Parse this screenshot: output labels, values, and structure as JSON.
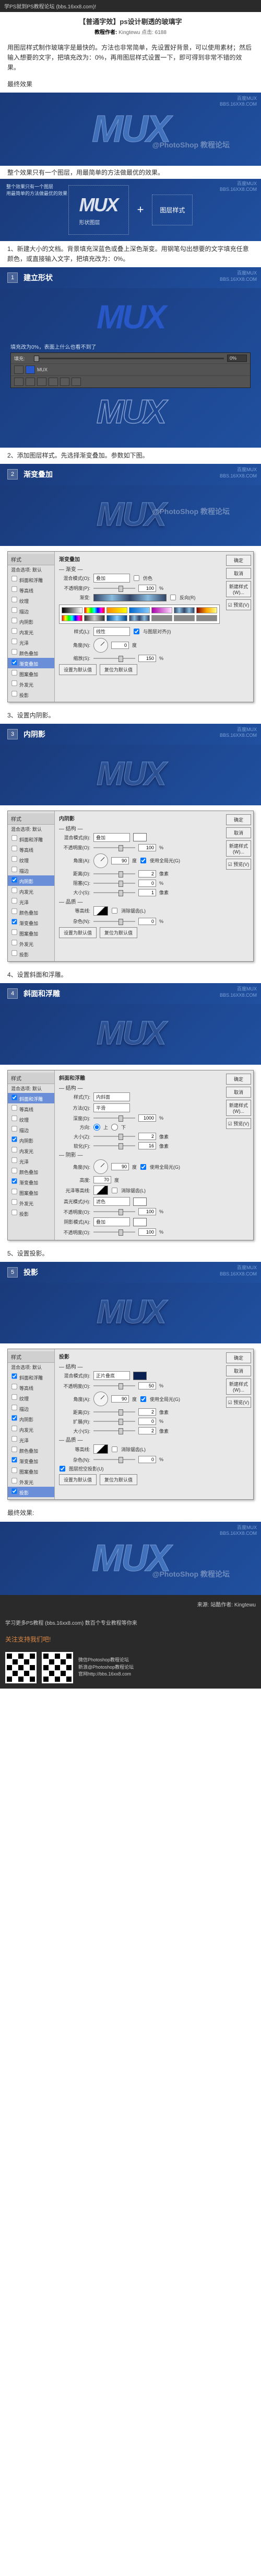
{
  "header": {
    "site": "学PS就到PS教程论坛 (bbs.16xx8.com)!"
  },
  "title": {
    "main": "【普通字效】ps设计剔透的玻璃字",
    "author_label": "教程作者:",
    "author": "Kingtewu",
    "meta": "点击: 6188"
  },
  "intro": "用图层样式制作玻璃字是最快的。方法也非常简单，先设置好背景，可以使用素材；然后输入想要的文字，把填充改为：0%，再用图层样式设置一下，即可得到非常不错的效果。",
  "final_label": "最终效果",
  "brand_label": {
    "l1": "百度MUX",
    "l2": "BBS.16XX8.COM"
  },
  "watermark": "@PhotoShop 教程论坛",
  "logo_text": "MUX",
  "caption_simple": "整个效果只有一个图层，用最简单的方法做最优的效果。",
  "formula": {
    "caption1": "整个效果只有一个图层",
    "caption2": "用最简单的方法做最优的效果",
    "left_label": "形状图层",
    "plus": "+",
    "right": "图层样式"
  },
  "step1": {
    "num": "1",
    "title": "建立形状",
    "text": "1、新建大小的文档。背景填充深蓝色或叠上深色渐变。用钢笔勾出想要的文字填充任意颜色，或直接输入文字，把填充改为：0%。",
    "fill_label": "填充改为0%，表面上什么也看不到了",
    "panel": {
      "fill": "填充:",
      "val": "0%",
      "layer": "MUX"
    }
  },
  "step2": {
    "num": "2",
    "title": "渐变叠加",
    "text": "2、添加图层样式。先选择渐变叠加。参数如下图。"
  },
  "step3": {
    "num": "3",
    "title": "内阴影",
    "text": "3、设置内阴影。"
  },
  "step4": {
    "num": "4",
    "title": "斜面和浮雕",
    "text": "4、设置斜面和浮雕。"
  },
  "step5": {
    "num": "5",
    "title": "投影",
    "text": "5、设置投影。"
  },
  "dialog": {
    "side_head": "样式",
    "items": [
      "混合选项: 默认",
      "斜面和浮雕",
      "等高线",
      "纹理",
      "描边",
      "内阴影",
      "内发光",
      "光泽",
      "颜色叠加",
      "渐变叠加",
      "图案叠加",
      "外发光",
      "投影"
    ],
    "btns": {
      "ok": "确定",
      "cancel": "取消",
      "new": "新建样式(W)...",
      "preview": "☑ 预览(V)"
    }
  },
  "grad": {
    "title": "渐变叠加",
    "section": "— 渐变 —",
    "blend": "混合模式(O):",
    "blend_v": "叠加",
    "dither": "仿色",
    "opacity": "不透明度(P):",
    "opacity_v": "100",
    "pct": "%",
    "gradient": "渐变:",
    "reverse": "反向(R)",
    "style": "样式(L):",
    "style_v": "线性",
    "align": "与图层对齐(I)",
    "angle": "角度(N):",
    "angle_v": "0",
    "deg": "度",
    "scale": "缩放(S):",
    "scale_v": "150",
    "default": "设置为默认值",
    "reset": "复位为默认值"
  },
  "inner": {
    "title": "内阴影",
    "section": "— 结构 —",
    "blend": "混合模式(B):",
    "blend_v": "叠加",
    "opacity": "不透明度(O):",
    "opacity_v": "100",
    "angle": "角度(A):",
    "angle_v": "90",
    "global": "使用全局光(G)",
    "dist": "距离(D):",
    "dist_v": "2",
    "px": "像素",
    "choke": "阻塞(C):",
    "choke_v": "0",
    "size": "大小(S):",
    "size_v": "1",
    "q": "— 品质 —",
    "contour": "等高线:",
    "aa": "消除锯齿(L)",
    "noise": "杂色(N):",
    "noise_v": "0"
  },
  "bevel": {
    "title": "斜面和浮雕",
    "section": "— 结构 —",
    "style": "样式(T):",
    "style_v": "内斜面",
    "tech": "方法(Q):",
    "tech_v": "平滑",
    "depth": "深度(D):",
    "depth_v": "1000",
    "dir": "方向:",
    "up": "上",
    "down": "下",
    "size": "大小(Z):",
    "size_v": "2",
    "soft": "软化(F):",
    "soft_v": "16",
    "shade": "— 阴影 —",
    "angle": "角度(N):",
    "angle_v": "90",
    "global": "使用全局光(G)",
    "alt": "高度:",
    "alt_v": "70",
    "gloss": "光泽等高线:",
    "aa": "消除锯齿(L)",
    "hmode": "高光模式(H):",
    "hmode_v": "滤色",
    "hop": "100",
    "smode": "阴影模式(A):",
    "smode_v": "叠加",
    "sop": "100"
  },
  "drop": {
    "title": "投影",
    "section": "— 结构 —",
    "blend": "混合模式(B):",
    "blend_v": "正片叠底",
    "opacity": "不透明度(O):",
    "opacity_v": "50",
    "angle": "角度(A):",
    "angle_v": "90",
    "global": "使用全局光(G)",
    "dist": "距离(D):",
    "dist_v": "2",
    "spread": "扩展(R):",
    "spread_v": "0",
    "size": "大小(S):",
    "size_v": "2",
    "q": "— 品质 —",
    "contour": "等高线:",
    "aa": "消除锯齿(L)",
    "noise": "杂色(N):",
    "noise_v": "0",
    "knock": "图层挖空投影(U)"
  },
  "final_text": "最终效果:",
  "footer": {
    "src": "来源: 站酷作者: Kingtewu",
    "line1": "学习更多PS教程 (bbs.16xx8.com) 数百个专业教程等你来",
    "slogan": "关注支持我们吧!",
    "f1": "微信Photoshop教程论坛",
    "f2": "新浪@Photoshop教程论坛",
    "f3": "官网http://bbs.16xx8.com"
  }
}
